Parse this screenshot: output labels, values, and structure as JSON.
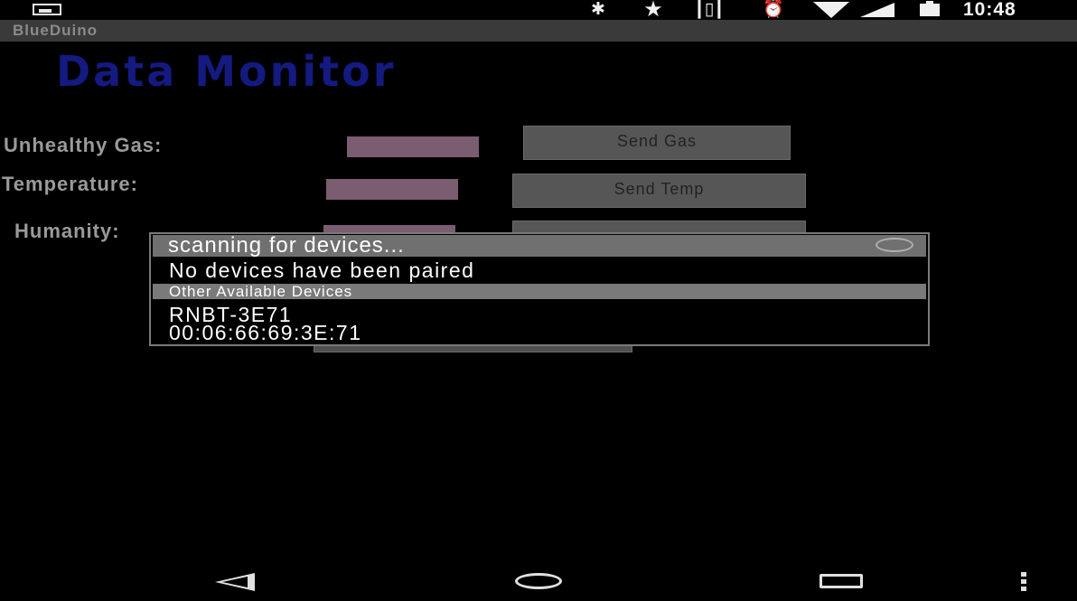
{
  "status_bar": {
    "time": "10:48",
    "icons": [
      "image-icon",
      "bluetooth-icon",
      "star-icon",
      "vibrate-icon",
      "alarm-icon",
      "wifi-icon",
      "signal-icon",
      "battery-icon"
    ]
  },
  "app": {
    "title": "BlueDuino"
  },
  "main": {
    "heading": "Data Monitor",
    "rows": [
      {
        "label": "Unhealthy Gas:",
        "button": "Send Gas"
      },
      {
        "label": "Temperature:",
        "button": "Send Temp"
      },
      {
        "label": "Humanity:",
        "button": ""
      }
    ]
  },
  "dialog": {
    "title": "scanning for devices...",
    "paired_message": "No devices have been paired",
    "section_header": "Other Available Devices",
    "devices": [
      {
        "name": "RNBT-3E71",
        "address": "00:06:66:69:3E:71"
      }
    ]
  },
  "nav_bar": {
    "icons": [
      "back-icon",
      "home-icon",
      "recents-icon",
      "menu-icon"
    ]
  },
  "colors": {
    "heading": "#141a80",
    "field": "#7a5d70",
    "title_bar": "#3a3a3a",
    "dialog_header": "#707070"
  }
}
